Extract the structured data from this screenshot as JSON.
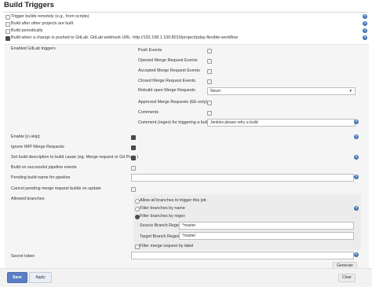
{
  "section_title": "Build Triggers",
  "triggers": [
    {
      "label": "Trigger builds remotely (e.g., from scripts)",
      "checked": false
    },
    {
      "label": "Build after other projects are built",
      "checked": false
    },
    {
      "label": "Build periodically",
      "checked": false
    },
    {
      "label": "Build when a change is pushed to GitLab. GitLab webhook URL: http://192.168.1.100:8010/project/pday-flexible-workflow",
      "checked": true
    }
  ],
  "gitlab": {
    "enabled_triggers_label": "Enabled GitLab triggers",
    "events": [
      {
        "label": "Push Events",
        "checked": false
      },
      {
        "label": "Opened Merge Request Events",
        "checked": false
      },
      {
        "label": "Accepted Merge Request Events",
        "checked": false
      },
      {
        "label": "Closed Merge Request Events",
        "checked": false
      }
    ],
    "rebuild_label": "Rebuild open Merge Requests",
    "rebuild_value": "Never",
    "approved_label": "Approved Merge Requests (EE-only)",
    "comments_label": "Comments",
    "comment_regex_label": "Comment (regex) for triggering a build",
    "comment_regex_value": "Jenkins please retry a build",
    "options": [
      {
        "label": "Enable [ci-skip]",
        "checked": true
      },
      {
        "label": "Ignore WIP Merge Requests",
        "checked": true
      },
      {
        "label": "Set build description to build cause (eg. Merge request or Git Push )",
        "checked": true
      },
      {
        "label": "Build on successful pipeline events",
        "checked": false
      }
    ],
    "pending_build_label": "Pending build name for pipeline",
    "pending_build_value": "",
    "cancel_pending_label": "Cancel pending merge request builds on update",
    "allowed_branches_label": "Allowed branches",
    "branch_options": [
      {
        "label": "Allow all branches to trigger this job",
        "checked": false
      },
      {
        "label": "Filter branches by name",
        "checked": false
      },
      {
        "label": "Filter branches by regex",
        "checked": true
      }
    ],
    "source_regex_label": "Source Branch Regex",
    "source_regex_value": "*master",
    "target_regex_label": "Target Branch Regex",
    "target_regex_value": "*master",
    "filter_label_label": "Filter merge request by label",
    "secret_token_label": "Secret token",
    "secret_token_value": "",
    "generate_label": "Generate",
    "clear_label": "Clear"
  },
  "footer": {
    "save_label": "Save",
    "apply_label": "Apply"
  },
  "icons": {
    "help": "question-icon"
  },
  "colors": {
    "help_icon": "#3f73b0",
    "save_button": "#5b7fc4"
  }
}
